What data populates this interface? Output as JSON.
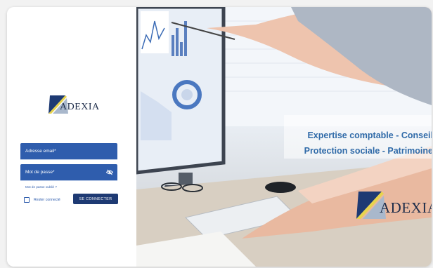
{
  "brand": {
    "name": "ADEXIA"
  },
  "login": {
    "email_placeholder": "Adresse email*",
    "password_placeholder": "Mot de passe*",
    "forgot_password": "Mot de passe oublié ?",
    "remember_me": "Rester connecté",
    "submit": "SE CONNECTER"
  },
  "hero": {
    "tagline_line1": "Expertise comptable - Conseil",
    "tagline_line2": "Protection sociale - Patrimoine"
  },
  "icons": [
    "eye-off-icon",
    "checkbox-icon",
    "adexia-logo"
  ],
  "colors": {
    "primary": "#2f5dad",
    "button": "#1e3a73",
    "tagline": "#2f6aa8",
    "logo_yellow": "#e8d44d"
  }
}
